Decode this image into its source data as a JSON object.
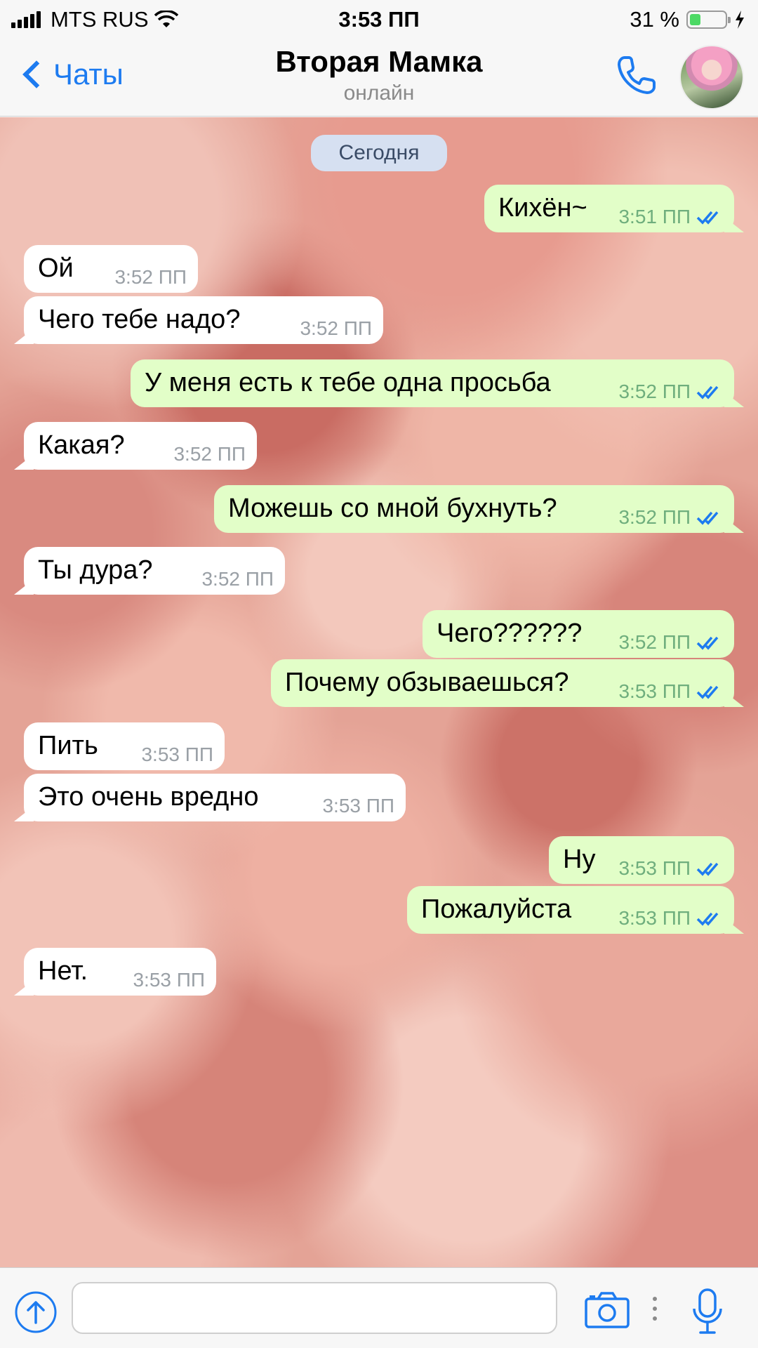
{
  "status_bar": {
    "carrier": "MTS RUS",
    "time": "3:53 ПП",
    "battery_percent": "31 %",
    "battery_level": 0.31
  },
  "nav": {
    "back_label": "Чаты",
    "title": "Вторая Мамка",
    "subtitle": "онлайн"
  },
  "chat": {
    "date_chip": "Сегодня",
    "messages": [
      {
        "dir": "out",
        "text": "Кихён~",
        "time": "3:51 ПП"
      },
      {
        "dir": "in",
        "text": "Ой",
        "time": "3:52 ПП"
      },
      {
        "dir": "in",
        "text": "Чего тебе надо?",
        "time": "3:52 ПП"
      },
      {
        "dir": "out",
        "text": "У меня есть к тебе одна просьба",
        "time": "3:52 ПП"
      },
      {
        "dir": "in",
        "text": "Какая?",
        "time": "3:52 ПП"
      },
      {
        "dir": "out",
        "text": "Можешь со мной бухнуть?",
        "time": "3:52 ПП"
      },
      {
        "dir": "in",
        "text": "Ты дура?",
        "time": "3:52 ПП"
      },
      {
        "dir": "out",
        "text": "Чего??????",
        "time": "3:52 ПП"
      },
      {
        "dir": "out",
        "text": "Почему обзываешься?",
        "time": "3:53 ПП"
      },
      {
        "dir": "in",
        "text": "Пить",
        "time": "3:53 ПП"
      },
      {
        "dir": "in",
        "text": "Это очень вредно",
        "time": "3:53 ПП"
      },
      {
        "dir": "out",
        "text": "Ну",
        "time": "3:53 ПП"
      },
      {
        "dir": "out",
        "text": "Пожалуйста",
        "time": "3:53 ПП"
      },
      {
        "dir": "in",
        "text": "Нет.",
        "time": "3:53 ПП"
      }
    ]
  },
  "input": {
    "placeholder": ""
  },
  "colors": {
    "accent": "#1d7bf0",
    "outgoing_bubble": "#e2fec8",
    "incoming_bubble": "#ffffff",
    "date_chip": "#d6e0f1"
  }
}
